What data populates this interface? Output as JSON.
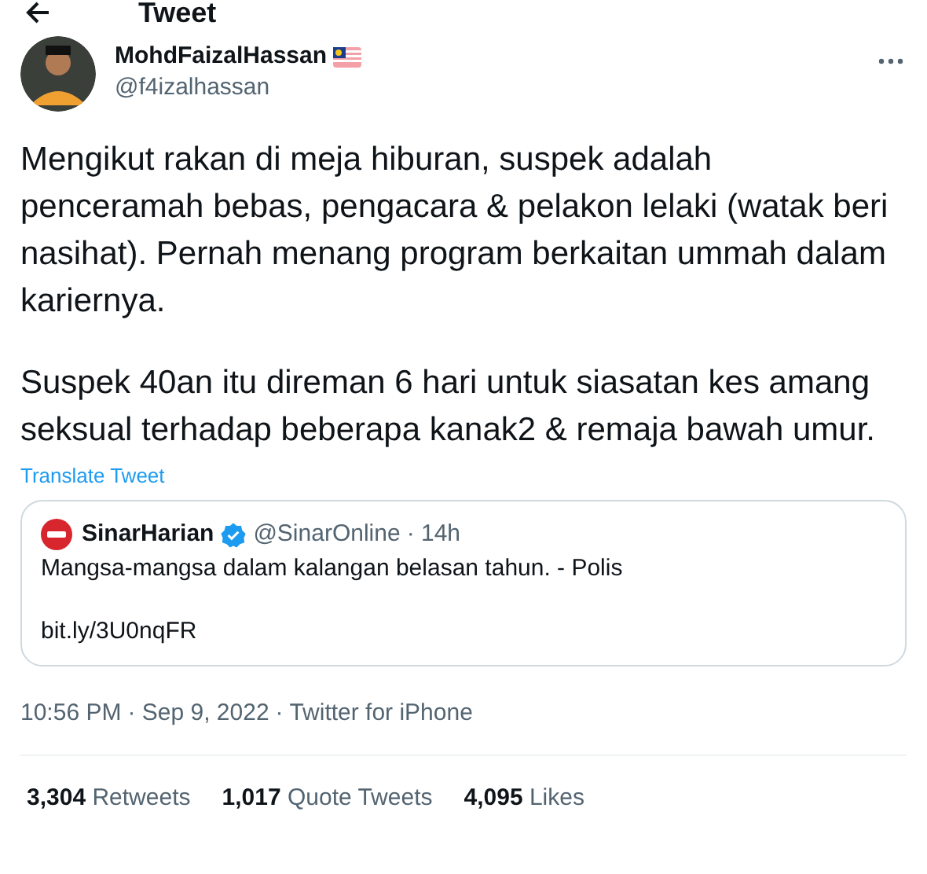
{
  "header": {
    "title": "Tweet"
  },
  "author": {
    "name": "MohdFaizalHassan",
    "handle": "@f4izalhassan"
  },
  "paragraphs": [
    "Mengikut rakan di meja hiburan, suspek adalah penceramah bebas, pengacara & pelakon lelaki (watak beri nasihat). Pernah menang program berkaitan ummah dalam kariernya.",
    "Suspek 40an itu direman 6 hari untuk siasatan kes amang seksual terhadap beberapa kanak2 & remaja bawah umur."
  ],
  "translate_link": "Translate Tweet",
  "quoted_tweet": {
    "name": "SinarHarian",
    "verified": true,
    "handle": "@SinarOnline",
    "time": "· 14h",
    "text": "Mangsa-mangsa dalam kalangan belasan tahun. - Polis",
    "link": "bit.ly/3U0nqFR"
  },
  "meta": {
    "time": "10:56 PM",
    "date": "· Sep 9, 2022",
    "source": "· Twitter for iPhone"
  },
  "stats": [
    {
      "count": "3,304",
      "label": "Retweets"
    },
    {
      "count": "1,017",
      "label": "Quote Tweets"
    },
    {
      "count": "4,095",
      "label": "Likes"
    }
  ]
}
